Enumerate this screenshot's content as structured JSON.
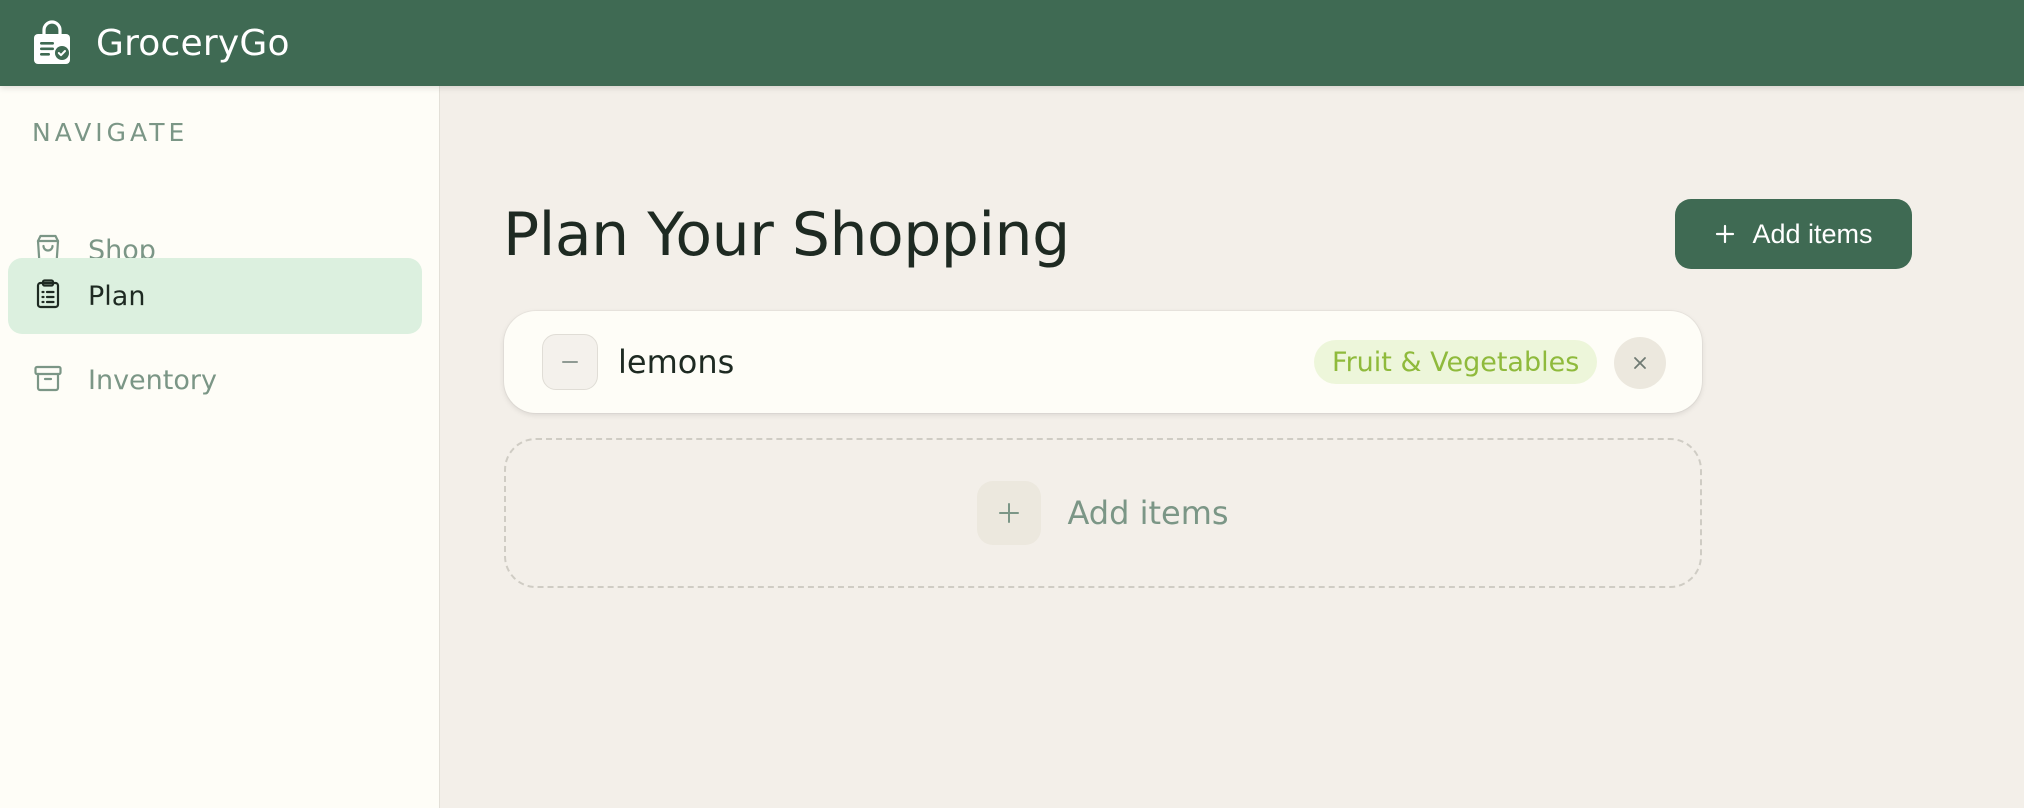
{
  "app": {
    "name": "GroceryGo",
    "logo_icon": "shopping-bag-check-icon"
  },
  "colors": {
    "brand": "#3f6a53",
    "sidebar_bg": "#fefdf7",
    "main_bg": "#f3efe9",
    "active_nav_bg": "#dcf0df",
    "muted_text": "#7b9686",
    "category_badge_bg": "#edf6da",
    "category_badge_text": "#8fba3c"
  },
  "sidebar": {
    "heading": "NAVIGATE",
    "items": [
      {
        "label": "Shop",
        "icon": "shopping-bag-icon",
        "active": false
      },
      {
        "label": "Plan",
        "icon": "clipboard-list-icon",
        "active": true
      },
      {
        "label": "Inventory",
        "icon": "archive-box-icon",
        "active": false
      }
    ]
  },
  "main": {
    "title": "Plan Your Shopping",
    "add_button_label": "Add items",
    "items": [
      {
        "name": "lemons",
        "category": "Fruit & Vegetables",
        "decrement_icon": "minus-icon",
        "remove_icon": "close-icon"
      }
    ],
    "add_zone_label": "Add items",
    "add_zone_icon": "plus-icon"
  }
}
